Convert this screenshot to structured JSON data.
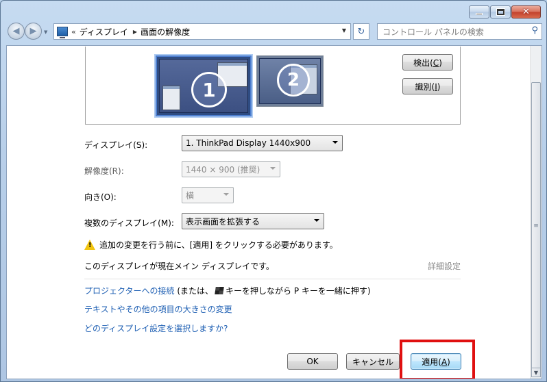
{
  "window": {
    "minimize_icon": "minimize-icon",
    "maximize_icon": "maximize-icon",
    "close_glyph": "✕"
  },
  "nav": {
    "back_glyph": "◀",
    "forward_glyph": "▶",
    "history_glyph": "▼",
    "breadcrumb_overflow": "«",
    "breadcrumb": [
      "ディスプレイ",
      "画面の解像度"
    ],
    "breadcrumb_separator": "▶",
    "address_drop": "▼",
    "refresh_glyph": "↻",
    "search_placeholder": "コントロール パネルの検索",
    "search_glyph": "⚲"
  },
  "preview": {
    "monitor1_number": "1",
    "monitor2_number": "2"
  },
  "buttons": {
    "detect": "検出(C)",
    "detect_key": "C",
    "identify": "識別(I)",
    "identify_key": "I",
    "ok": "OK",
    "cancel": "キャンセル",
    "apply": "適用(A)",
    "apply_key": "A"
  },
  "settings": {
    "display_label": "ディスプレイ(S):",
    "display_value": "1. ThinkPad Display 1440x900",
    "resolution_label": "解像度(R):",
    "resolution_value": "1440 × 900 (推奨)",
    "orientation_label": "向き(O):",
    "orientation_value": "横",
    "multi_label": "複数のディスプレイ(M):",
    "multi_value": "表示画面を拡張する"
  },
  "messages": {
    "warning": "追加の変更を行う前に、[適用] をクリックする必要があります。",
    "main_display": "このディスプレイが現在メイン ディスプレイです。",
    "advanced": "詳細設定"
  },
  "links": {
    "projector": "プロジェクターへの接続",
    "projector_note_pre": "(または、",
    "projector_note_post": "キーを押しながら P キーを一緒に押す)",
    "text_size": "テキストやその他の項目の大きさの変更",
    "which_settings": "どのディスプレイ設定を選択しますか?"
  },
  "scrollbar": {
    "grip": "≡",
    "down_glyph": "▼"
  },
  "colors": {
    "link": "#1e5fb3",
    "highlight": "#e01010",
    "apply_border": "#3c7fb1"
  }
}
